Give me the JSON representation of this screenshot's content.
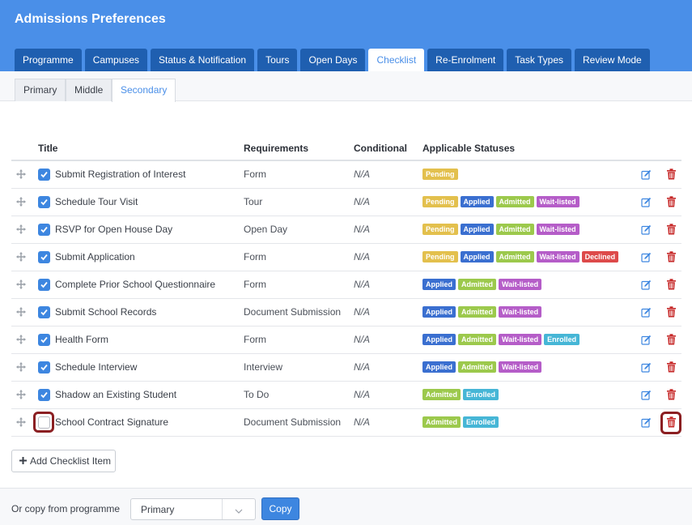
{
  "header": {
    "title": "Admissions Preferences"
  },
  "tabs": [
    {
      "label": "Programme"
    },
    {
      "label": "Campuses"
    },
    {
      "label": "Status & Notification"
    },
    {
      "label": "Tours"
    },
    {
      "label": "Open Days"
    },
    {
      "label": "Checklist",
      "active": true
    },
    {
      "label": "Re-Enrolment"
    },
    {
      "label": "Task Types"
    },
    {
      "label": "Review Mode"
    }
  ],
  "subtabs": [
    {
      "label": "Primary"
    },
    {
      "label": "Middle"
    },
    {
      "label": "Secondary",
      "active": true
    }
  ],
  "table": {
    "headers": {
      "title": "Title",
      "requirements": "Requirements",
      "conditional": "Conditional",
      "statuses": "Applicable Statuses"
    },
    "rows": [
      {
        "checked": true,
        "title": "Submit Registration of Interest",
        "requirement": "Form",
        "conditional": "N/A",
        "statuses": [
          "Pending"
        ]
      },
      {
        "checked": true,
        "title": "Schedule Tour Visit",
        "requirement": "Tour",
        "conditional": "N/A",
        "statuses": [
          "Pending",
          "Applied",
          "Admitted",
          "Wait-listed"
        ]
      },
      {
        "checked": true,
        "title": "RSVP for Open House Day",
        "requirement": "Open Day",
        "conditional": "N/A",
        "statuses": [
          "Pending",
          "Applied",
          "Admitted",
          "Wait-listed"
        ]
      },
      {
        "checked": true,
        "title": "Submit Application",
        "requirement": "Form",
        "conditional": "N/A",
        "statuses": [
          "Pending",
          "Applied",
          "Admitted",
          "Wait-listed",
          "Declined"
        ]
      },
      {
        "checked": true,
        "title": "Complete Prior School Questionnaire",
        "requirement": "Form",
        "conditional": "N/A",
        "statuses": [
          "Applied",
          "Admitted",
          "Wait-listed"
        ]
      },
      {
        "checked": true,
        "title": "Submit School Records",
        "requirement": "Document Submission",
        "conditional": "N/A",
        "statuses": [
          "Applied",
          "Admitted",
          "Wait-listed"
        ]
      },
      {
        "checked": true,
        "title": "Health Form",
        "requirement": "Form",
        "conditional": "N/A",
        "statuses": [
          "Applied",
          "Admitted",
          "Wait-listed",
          "Enrolled"
        ]
      },
      {
        "checked": true,
        "title": "Schedule Interview",
        "requirement": "Interview",
        "conditional": "N/A",
        "statuses": [
          "Applied",
          "Admitted",
          "Wait-listed"
        ]
      },
      {
        "checked": true,
        "title": "Shadow an Existing Student",
        "requirement": "To Do",
        "conditional": "N/A",
        "statuses": [
          "Admitted",
          "Enrolled"
        ]
      },
      {
        "checked": false,
        "highlighted": true,
        "title": "School Contract Signature",
        "requirement": "Document Submission",
        "conditional": "N/A",
        "statuses": [
          "Admitted",
          "Enrolled"
        ]
      }
    ]
  },
  "status_colors": {
    "Pending": "#e3c04d",
    "Applied": "#3a6fd0",
    "Admitted": "#9cc94c",
    "Wait-listed": "#b55dc8",
    "Declined": "#dd4a4a",
    "Enrolled": "#46b6d6"
  },
  "icons": {
    "drag": "move-icon",
    "edit": "edit-icon",
    "delete": "trash-icon",
    "add": "plus-icon",
    "dropdown": "chevron-down-icon"
  },
  "add_button": {
    "label": "Add Checklist Item"
  },
  "footer": {
    "label": "Or copy from programme",
    "select_value": "Primary",
    "copy_label": "Copy"
  },
  "colors": {
    "header_bg": "#4a8fe8",
    "tab_bg": "#1f5fb0",
    "accent": "#3d86e0",
    "delete_red": "#c62828",
    "highlight_ring": "#8b1f22"
  }
}
